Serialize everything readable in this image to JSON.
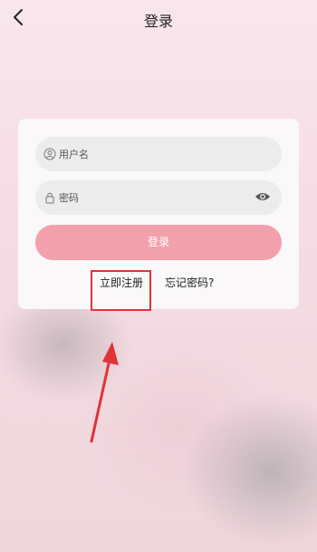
{
  "header": {
    "title": "登录",
    "back_icon": "chevron-left-icon"
  },
  "form": {
    "username_placeholder": "用户名",
    "username_icon": "user-icon",
    "password_placeholder": "密码",
    "password_icon": "lock-icon",
    "visibility_icon": "eye-icon",
    "login_label": "登录",
    "register_label": "立即注册",
    "forgot_label": "忘记密码?"
  },
  "colors": {
    "login_button": "#f3a0ad",
    "annotation_red": "#e0333a"
  }
}
